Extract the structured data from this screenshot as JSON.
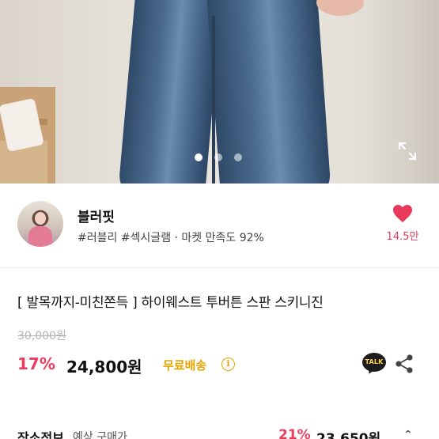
{
  "gallery": {
    "slide_count": 3,
    "active_slide": 1
  },
  "shop": {
    "name": "블러핏",
    "tags": "#러블리 #섹시글램 · 마켓 만족도 92%",
    "likes": "14.5만"
  },
  "product": {
    "title": "[ 발목까지-미친쫀득 ] 하이웨스트 투버튼 스판 스키니진",
    "original_price": "30,000원",
    "discount": "17%",
    "price": "24,800원",
    "shipping_label": "무료배송",
    "info_icon": "i"
  },
  "icons": {
    "talk_label": "TALK"
  },
  "bottom_row": {
    "label": "장소정보",
    "sub": "예상 구매가",
    "discount": "21%",
    "price": "23,650원",
    "chevron": "⌃"
  },
  "colors": {
    "accent_pink": "#ee3c5e",
    "shipping_yellow": "#e7a400",
    "heart_red": "#e8395b"
  }
}
